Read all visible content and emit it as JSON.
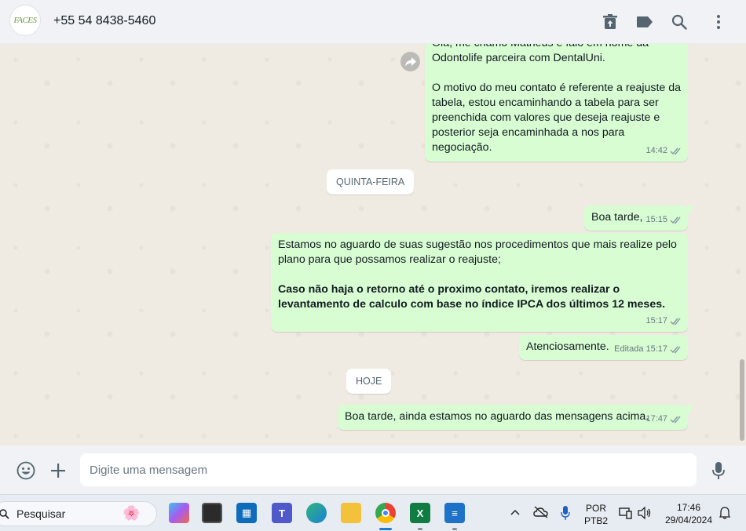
{
  "header": {
    "avatar_text": "FACES",
    "contact_name": "+55 54 8438-5460",
    "icons": [
      "delete-icon",
      "label-icon",
      "search-icon",
      "menu-icon"
    ]
  },
  "messages": [
    {
      "id": "m1",
      "lines_top": "Olá, me chamo Matheus e falo em nome da",
      "line2": "Odontolife parceira com DentalUni.",
      "para2_l1": "O motivo do meu contato é referente a reajuste da",
      "para2_l2": "tabela, estou encaminhando a tabela para ser",
      "para2_l3": "preenchida com valores que deseja reajuste e",
      "para2_l4": "posterior seja encaminhada a nos para negociação.",
      "time": "14:42"
    },
    {
      "id": "day1",
      "chip": "QUINTA-FEIRA"
    },
    {
      "id": "m2",
      "text": "Boa tarde,",
      "time": "15:15"
    },
    {
      "id": "m3",
      "l1": "Estamos no aguardo de suas sugestão nos procedimentos que mais realize pelo",
      "l2": "plano para que possamos realizar o reajuste;",
      "b1": "Caso não haja o retorno até o proximo contato, iremos realizar o",
      "b2": "levantamento de calculo com base no índice IPCA dos últimos 12 meses.",
      "time": "15:17"
    },
    {
      "id": "m4",
      "text": "Atenciosamente.",
      "edited": "Editada",
      "time": "15:17"
    },
    {
      "id": "day2",
      "chip": "HOJE"
    },
    {
      "id": "m5",
      "text": "Boa tarde, ainda estamos no aguardo das mensagens acima.",
      "time": "17:47"
    }
  ],
  "composer": {
    "placeholder": "Digite uma mensagem",
    "icons": [
      "emoji-icon",
      "attach-plus-icon",
      "microphone-icon"
    ]
  },
  "taskbar": {
    "search_placeholder": "Pesquisar",
    "lang_line1": "POR",
    "lang_line2": "PTB2",
    "clock_time": "17:46",
    "clock_date": "29/04/2024",
    "colors": {
      "accent": "#1f7ad4",
      "bubble_out": "#d9fdd3",
      "tick_read": "#8696a0"
    }
  }
}
